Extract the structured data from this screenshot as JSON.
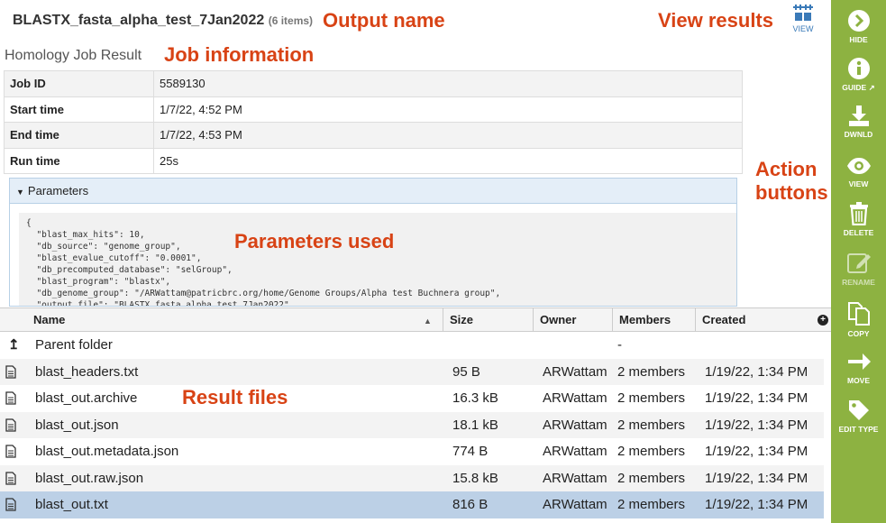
{
  "header": {
    "title": "BLASTX_fasta_alpha_test_7Jan2022",
    "item_count": "(6 items)",
    "view_label": "VIEW"
  },
  "annotations": {
    "output_name": "Output name",
    "view_results": "View results",
    "job_information": "Job information",
    "parameters_used": "Parameters used",
    "action_buttons_line1": "Action",
    "action_buttons_line2": "buttons",
    "result_files": "Result files"
  },
  "job": {
    "heading": "Homology Job Result",
    "rows": [
      {
        "key": "Job ID",
        "value": "5589130"
      },
      {
        "key": "Start time",
        "value": "1/7/22, 4:52 PM"
      },
      {
        "key": "End time",
        "value": "1/7/22, 4:53 PM"
      },
      {
        "key": "Run time",
        "value": "25s"
      }
    ]
  },
  "parameters": {
    "label": "Parameters",
    "json_text": "{\n  \"blast_max_hits\": 10,\n  \"db_source\": \"genome_group\",\n  \"blast_evalue_cutoff\": \"0.0001\",\n  \"db_precomputed_database\": \"selGroup\",\n  \"blast_program\": \"blastx\",\n  \"db_genome_group\": \"/ARWattam@patricbrc.org/home/Genome Groups/Alpha test Buchnera group\",\n  \"output_file\": \"BLASTX_fasta_alpha_test_7Jan2022\","
  },
  "grid": {
    "columns": {
      "name": "Name",
      "size": "Size",
      "owner": "Owner",
      "members": "Members",
      "created": "Created"
    },
    "parent": {
      "name": "Parent folder",
      "members": "-"
    },
    "rows": [
      {
        "name": "blast_headers.txt",
        "size": "95 B",
        "owner": "ARWattam",
        "members": "2 members",
        "created": "1/19/22, 1:34 PM"
      },
      {
        "name": "blast_out.archive",
        "size": "16.3 kB",
        "owner": "ARWattam",
        "members": "2 members",
        "created": "1/19/22, 1:34 PM"
      },
      {
        "name": "blast_out.json",
        "size": "18.1 kB",
        "owner": "ARWattam",
        "members": "2 members",
        "created": "1/19/22, 1:34 PM"
      },
      {
        "name": "blast_out.metadata.json",
        "size": "774 B",
        "owner": "ARWattam",
        "members": "2 members",
        "created": "1/19/22, 1:34 PM"
      },
      {
        "name": "blast_out.raw.json",
        "size": "15.8 kB",
        "owner": "ARWattam",
        "members": "2 members",
        "created": "1/19/22, 1:34 PM"
      },
      {
        "name": "blast_out.txt",
        "size": "816 B",
        "owner": "ARWattam",
        "members": "2 members",
        "created": "1/19/22, 1:34 PM"
      }
    ]
  },
  "actions": {
    "hide": "HIDE",
    "guide": "GUIDE",
    "download": "DWNLD",
    "view": "VIEW",
    "delete": "DELETE",
    "rename": "RENAME",
    "copy": "COPY",
    "move": "MOVE",
    "edit_type": "EDIT TYPE"
  },
  "colors": {
    "sidebar": "#8db241",
    "annotation": "#d84315",
    "selected_row": "#bcd0e6"
  }
}
